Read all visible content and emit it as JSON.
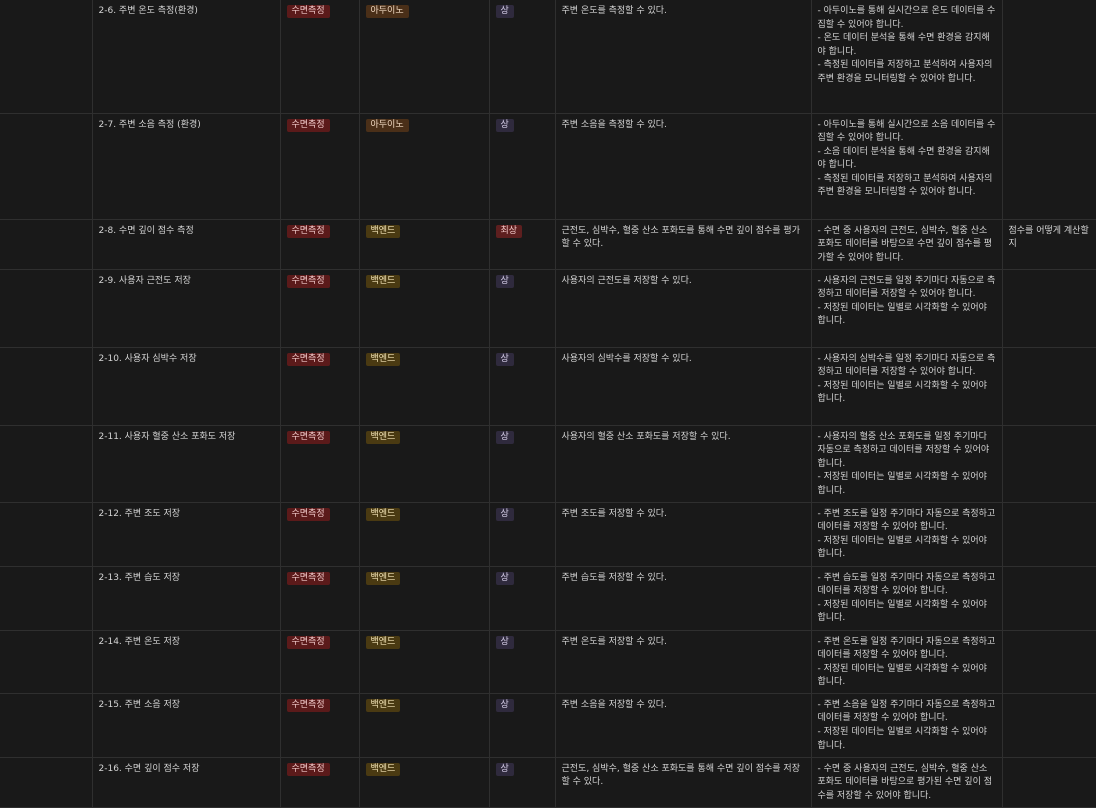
{
  "rows": [
    {
      "feature": "2-6. 주변 온도 측정(환경)",
      "category": "수면측정",
      "module": "아두이노",
      "module_color": "brown",
      "priority": "상",
      "priority_color": "purple",
      "description": "주변 온도를 측정할 수 있다.",
      "requirements": [
        "- 아두이노를 통해 실시간으로 온도 데이터를 수집할 수 있어야 합니다.",
        "- 온도 데이터 분석을 통해 수면 환경을 감지해야 합니다.",
        "- 측정된 데이터를 저장하고 분석하여 사용자의 주변 환경을 모니터링할 수 있어야 합니다."
      ],
      "note": ""
    },
    {
      "feature": "2-7. 주변 소음 측정 (환경)",
      "category": "수면측정",
      "module": "아두이노",
      "module_color": "brown",
      "priority": "상",
      "priority_color": "purple",
      "description": "주변 소음을 측정할 수 있다.",
      "requirements": [
        "- 아두이노를 통해 실시간으로 소음 데이터를 수집할 수 있어야 합니다.",
        "- 소음 데이터 분석을 통해 수면 환경을 감지해야 합니다.",
        "- 측정된 데이터를 저장하고 분석하여 사용자의 주변 환경을 모니터링할 수 있어야 합니다."
      ],
      "note": ""
    },
    {
      "feature": "2-8. 수면 깊이 점수 측정",
      "category": "수면측정",
      "module": "백엔드",
      "module_color": "yellow",
      "priority": "최상",
      "priority_color": "crit",
      "description": "근전도, 심박수, 혈중 산소 포화도를 통해 수면 깊이 점수를 평가할 수 있다.",
      "requirements": [
        "- 수면 중 사용자의 근전도, 심박수, 혈중 산소 포화도 데이터를 바탕으로 수면 깊이 점수를 평가할 수 있어야 합니다."
      ],
      "note": "점수를 어떻게 계산할지"
    },
    {
      "feature": "2-9. 사용자 근전도 저장",
      "category": "수면측정",
      "module": "백엔드",
      "module_color": "yellow",
      "priority": "상",
      "priority_color": "purple",
      "description": "사용자의 근전도를 저장할 수 있다.",
      "requirements": [
        "- 사용자의 근전도를 일정 주기마다 자동으로 측정하고 데이터를 저장할 수 있어야 합니다.",
        "- 저장된 데이터는 일별로 시각화할 수 있어야 합니다."
      ],
      "note": ""
    },
    {
      "feature": "2-10. 사용자 심박수 저장",
      "category": "수면측정",
      "module": "백엔드",
      "module_color": "yellow",
      "priority": "상",
      "priority_color": "purple",
      "description": "사용자의 심박수를 저장할 수 있다.",
      "requirements": [
        "- 사용자의 심박수를 일정 주기마다 자동으로 측정하고 데이터를 저장할 수 있어야 합니다.",
        "- 저장된 데이터는 일별로 시각화할 수 있어야 합니다."
      ],
      "note": ""
    },
    {
      "feature": "2-11. 사용자 혈중 산소 포화도 저장",
      "category": "수면측정",
      "module": "백엔드",
      "module_color": "yellow",
      "priority": "상",
      "priority_color": "purple",
      "description": "사용자의 혈중 산소 포화도를 저장할 수 있다.",
      "requirements": [
        "- 사용자의 혈중 산소 포화도를 일정 주기마다 자동으로 측정하고 데이터를 저장할 수 있어야 합니다.",
        "- 저장된 데이터는 일별로 시각화할 수 있어야 합니다."
      ],
      "note": ""
    },
    {
      "feature": "2-12. 주변 조도 저장",
      "category": "수면측정",
      "module": "백엔드",
      "module_color": "yellow",
      "priority": "상",
      "priority_color": "purple",
      "description": "주변 조도를 저장할 수 있다.",
      "requirements": [
        "- 주변 조도를 일정 주기마다 자동으로 측정하고 데이터를 저장할 수 있어야 합니다.",
        "- 저장된 데이터는 일별로 시각화할 수 있어야 합니다."
      ],
      "note": ""
    },
    {
      "feature": "2-13. 주변 습도 저장",
      "category": "수면측정",
      "module": "백엔드",
      "module_color": "yellow",
      "priority": "상",
      "priority_color": "purple",
      "description": "주변 습도를 저장할 수 있다.",
      "requirements": [
        "- 주변 습도를 일정 주기마다 자동으로 측정하고 데이터를 저장할 수 있어야 합니다.",
        "- 저장된 데이터는 일별로 시각화할 수 있어야 합니다."
      ],
      "note": ""
    },
    {
      "feature": "2-14. 주변 온도 저장",
      "category": "수면측정",
      "module": "백엔드",
      "module_color": "yellow",
      "priority": "상",
      "priority_color": "purple",
      "description": "주변 온도를 저장할 수 있다.",
      "requirements": [
        "- 주변 온도를 일정 주기마다 자동으로 측정하고 데이터를 저장할 수 있어야 합니다.",
        "- 저장된 데이터는 일별로 시각화할 수 있어야 합니다."
      ],
      "note": ""
    },
    {
      "feature": "2-15. 주변 소음 저장",
      "category": "수면측정",
      "module": "백엔드",
      "module_color": "yellow",
      "priority": "상",
      "priority_color": "purple",
      "description": "주변 소음을 저장할 수 있다.",
      "requirements": [
        "- 주변 소음을 일정 주기마다 자동으로 측정하고 데이터를 저장할 수 있어야 합니다.",
        "- 저장된 데이터는 일별로 시각화할 수 있어야 합니다."
      ],
      "note": ""
    },
    {
      "feature": "2-16. 수면 깊이 점수 저장",
      "category": "수면측정",
      "module": "백엔드",
      "module_color": "yellow",
      "priority": "상",
      "priority_color": "purple",
      "description": "근전도, 심박수, 혈중 산소 포화도를 통해 수면 깊이 점수를 저장할 수 있다.",
      "requirements": [
        "- 수면 중 사용자의 근전도, 심박수, 혈중 산소 포화도 데이터를 바탕으로 평가된 수면 깊이 점수를 저장할 수 있어야 합니다."
      ],
      "note": ""
    }
  ]
}
